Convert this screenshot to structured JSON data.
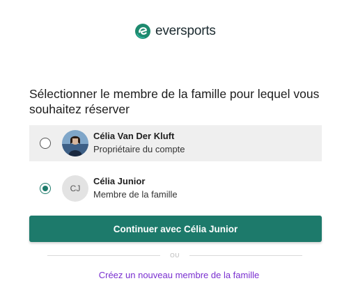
{
  "brand": {
    "name": "eversports",
    "logo_icon": "eversports-logo-icon",
    "accent_color": "#1d7a6b"
  },
  "heading": "Sélectionner le membre de la famille pour lequel vous souhaitez réserver",
  "members": [
    {
      "name": "Célia Van Der Kluft",
      "role": "Propriétaire du compte",
      "avatar": "photo",
      "selected": false
    },
    {
      "name": "Célia Junior",
      "role": "Membre de la famille",
      "avatar_initials": "CJ",
      "selected": true
    }
  ],
  "continue_button": "Continuer avec Célia Junior",
  "divider_text": "OU",
  "create_link": "Créez un nouveau membre de la famille",
  "colors": {
    "primary": "#1d7a6b",
    "link": "#7a2fd0",
    "highlight_row": "#efefef"
  }
}
